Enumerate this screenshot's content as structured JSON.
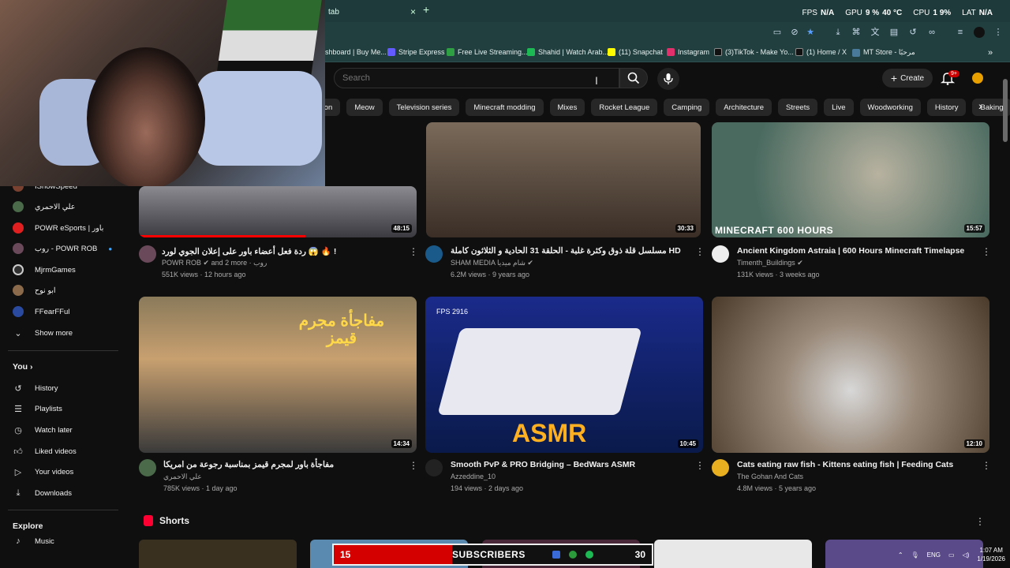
{
  "browser": {
    "tab_title": "tab",
    "tab_close": "×",
    "new_tab": "+",
    "perf": {
      "fps_label": "FPS",
      "fps_value": "N/A",
      "gpu_label": "GPU",
      "gpu_value": "9 %",
      "gpu_temp": "40 °C",
      "cpu_label": "CPU",
      "cpu_value": "1 9%",
      "lat_label": "LAT",
      "lat_value": "N/A"
    },
    "bookmarks": [
      {
        "label": "shboard | Buy Me...",
        "color": "#3a6e8f"
      },
      {
        "label": "Stripe Express",
        "color": "#635bff"
      },
      {
        "label": "Free Live Streaming...",
        "color": "#2ea043"
      },
      {
        "label": "Shahid | Watch Arab...",
        "color": "#1db954"
      },
      {
        "label": "(11) Snapchat",
        "color": "#fffc00"
      },
      {
        "label": "Instagram",
        "color": "#e1306c"
      },
      {
        "label": "(3)TikTok - Make Yo...",
        "color": "#000000"
      },
      {
        "label": "(1) Home / X",
        "color": "#000000"
      },
      {
        "label": "MT Store - مرحبًا",
        "color": "#4a7a9a"
      }
    ]
  },
  "header": {
    "search_placeholder": "Search",
    "create_label": "Create",
    "notif_count": "9+"
  },
  "chips": [
    "tion",
    "Meow",
    "Television series",
    "Minecraft modding",
    "Mixes",
    "Rocket League",
    "Camping",
    "Architecture",
    "Streets",
    "Live",
    "Woodworking",
    "History",
    "Baking"
  ],
  "sidebar": {
    "subscriptions": [
      {
        "label": "IShowSpeed",
        "color": "#7a4030"
      },
      {
        "label": "علي الاحمري",
        "color": "#4a6a4a"
      },
      {
        "label": "POWR eSports | باور",
        "color": "#e02020"
      },
      {
        "label": "روب - POWR ROB",
        "color": "#6a4a5a"
      },
      {
        "label": "MjrmGames",
        "color": "#303030"
      },
      {
        "label": "ابو نوح",
        "color": "#8a6a4a"
      },
      {
        "label": "FFearFFul",
        "color": "#2a4aa0"
      }
    ],
    "show_more": "Show more",
    "you_label": "You",
    "you_items": [
      {
        "label": "History",
        "icon": "history-icon"
      },
      {
        "label": "Playlists",
        "icon": "playlists-icon"
      },
      {
        "label": "Watch later",
        "icon": "watch-later-icon"
      },
      {
        "label": "Liked videos",
        "icon": "liked-videos-icon"
      },
      {
        "label": "Your videos",
        "icon": "your-videos-icon"
      },
      {
        "label": "Downloads",
        "icon": "downloads-icon"
      }
    ],
    "explore_label": "Explore",
    "explore_partial": "Music"
  },
  "videos": [
    {
      "title": "ردة فعل أعضاء باور على إعلان الجوي لورد 😱 🔥 !",
      "channel": "POWR ROB",
      "channel_extra": "and 2 more · روب",
      "meta": "551K views · 12 hours ago",
      "duration": "48:15",
      "thumb": "#5a5a62"
    },
    {
      "title": "مسلسل قلة ذوق وكثرة غلبة - الحلقة 31 الحادية و الثلاثون كاملة HD",
      "channel": "SHAM MEDIA",
      "channel_extra": "شام ميديا",
      "meta": "6.2M views · 9 years ago",
      "duration": "30:33",
      "thumb": "#5a4e44"
    },
    {
      "title": "Ancient Kingdom Astraia | 600 Hours Minecraft Timelapse",
      "channel": "Timenth_Buildings",
      "channel_extra": "",
      "meta": "131K views · 3 weeks ago",
      "duration": "15:57",
      "thumb": "#5a6a62",
      "thumb_caption": "MINECRAFT 600 HOURS"
    },
    {
      "title": "مفاجأة باور لمجرم قيمز بمناسبة رجوعة من امريكا",
      "channel": "علي الاحمري",
      "channel_extra": "",
      "meta": "785K views · 1 day ago",
      "duration": "14:34",
      "thumb": "#6a5a48",
      "thumb_caption": "مفاجأة مجرم قيمز"
    },
    {
      "title": "Smooth PvP & PRO Bridging – BedWars ASMR",
      "channel": "Azzeddine_10",
      "channel_extra": "",
      "meta": "194 views · 2 days ago",
      "duration": "10:45",
      "thumb": "#1a2a6a",
      "thumb_caption": "ASMR",
      "thumb_overlay": "FPS 2916"
    },
    {
      "title": "Cats eating raw fish - Kittens eating fish | Feeding Cats",
      "channel": "The Gohan And Cats",
      "channel_extra": "",
      "meta": "4.8M views · 5 years ago",
      "duration": "12:10",
      "thumb": "#6a6460"
    }
  ],
  "shorts_label": "Shorts",
  "subscriber_goal": {
    "current": "15",
    "label": "SUBSCRIBERS",
    "goal": "30"
  },
  "tray": {
    "lang": "ENG",
    "time": "1:07 AM",
    "date": "1/19/2026"
  }
}
